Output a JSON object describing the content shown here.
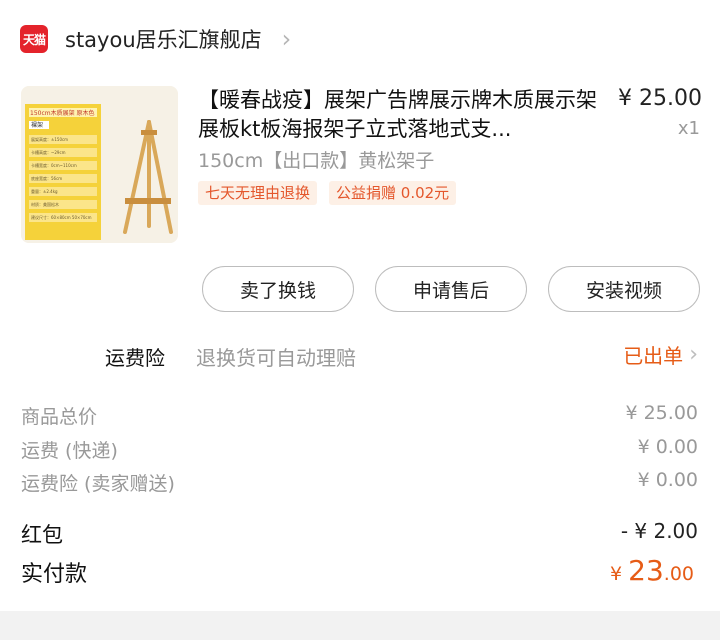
{
  "store": {
    "logo_text": "天猫",
    "name": "stayou居乐汇旗舰店",
    "chevron_icon": "chevron-right-icon"
  },
  "product": {
    "image_icon": "easel-product-photo",
    "image_texts": [
      "150cm木质展架 原木色",
      "裸架",
      "展架高度：±150cm",
      "卡槽高度：~29cm",
      "卡槽宽度：0cm~110cm",
      "底座宽度：56cm",
      "重量：±2.4kg",
      "材质：美国松木",
      "建议尺寸：60×80cm 50×70cm"
    ],
    "title": "【暖春战疫】展架广告牌展示牌木质展示架展板kt板海报架子立式落地式支...",
    "sku": "150cm【出口款】黄松架子",
    "price": "¥ 25.00",
    "quantity": "x1",
    "tags": [
      "七天无理由退换",
      "公益捐赠 0.02元"
    ]
  },
  "actions": {
    "sell_label": "卖了换钱",
    "after_sale_label": "申请售后",
    "install_video_label": "安装视频"
  },
  "insurance": {
    "label": "运费险",
    "description": "退换货可自动理赔",
    "status": "已出单"
  },
  "summary": {
    "rows": [
      {
        "label": "商品总价",
        "value": "¥ 25.00"
      },
      {
        "label": "运费 (快递)",
        "value": "¥ 0.00"
      },
      {
        "label": "运费险 (卖家赠送)",
        "value": "¥ 0.00"
      }
    ],
    "red_packet_label": "红包",
    "red_packet_value": "- ¥ 2.00",
    "paid_label": "实付款",
    "paid_currency": "¥",
    "paid_integer": "23",
    "paid_decimal": ".00"
  },
  "colors": {
    "accent": "#e65c17",
    "tmall_red": "#e4232b",
    "muted": "#999999",
    "tag_bg": "#fdf0e6"
  }
}
